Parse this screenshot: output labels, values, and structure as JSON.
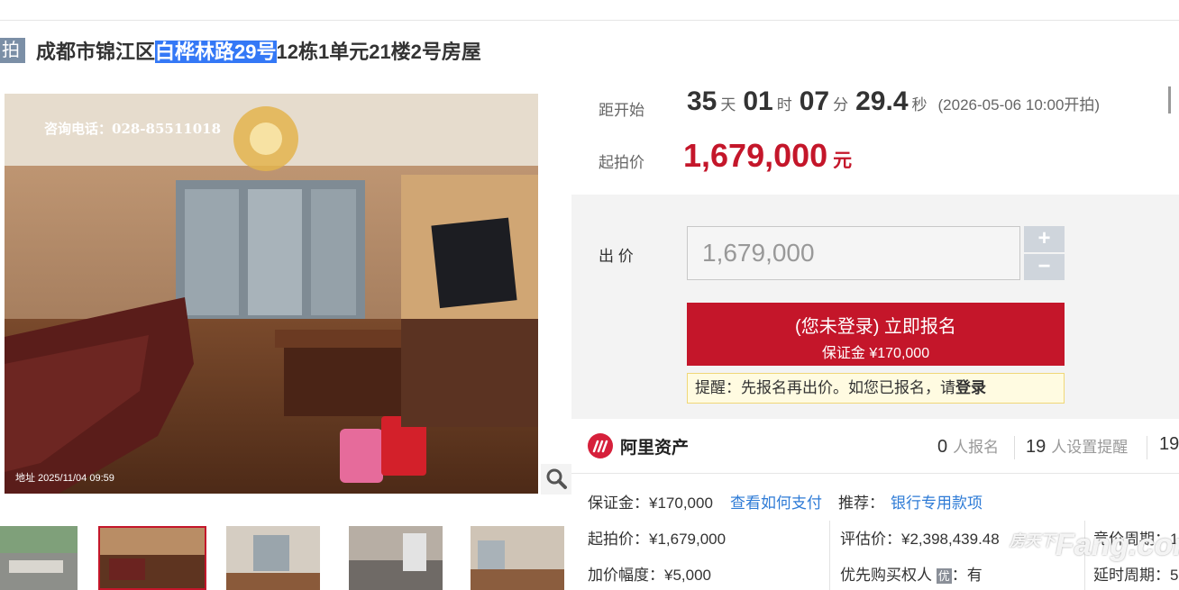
{
  "header": {
    "tag": "拍",
    "title_pre": "成都市锦江区",
    "title_highlight": "白桦林路29号",
    "title_post": "12栋1单元21楼2号房屋"
  },
  "photo": {
    "contact_overlay": "咨询电话：028-85511018",
    "stamp_overlay": "地址  2025/11/04 09:59"
  },
  "auction": {
    "countdown_label": "距开始",
    "days": "35",
    "days_unit": "天",
    "hours": "01",
    "hours_unit": "时",
    "minutes": "07",
    "minutes_unit": "分",
    "seconds": "29.4",
    "seconds_unit": "秒",
    "start_note": "(2026-05-06 10:00开拍)",
    "start_price_label": "起拍价",
    "start_price": "1,679,000",
    "start_price_unit": "元"
  },
  "bid": {
    "label": "出 价",
    "input_placeholder": "1,679,000",
    "plus": "+",
    "minus": "−",
    "signup_line1": "(您未登录) 立即报名",
    "signup_line2": "保证金 ¥170,000",
    "reminder_text": "提醒：先报名再出价。如您已报名，请",
    "reminder_link": "登录"
  },
  "platform": {
    "name": "阿里资产",
    "signups_count": "0",
    "signups_label": "人报名",
    "reminders_count": "19",
    "reminders_label": "人设置提醒",
    "views_count": "19"
  },
  "details": {
    "deposit": "保证金：¥170,000",
    "how_to_pay": "查看如何支付",
    "recommend_label": "推荐：",
    "recommend_link": "银行专用款项",
    "start_price": "起拍价：¥1,679,000",
    "appraisal": "评估价：¥2,398,439.48",
    "bid_cycle": "竞价周期：1",
    "increment": "加价幅度：¥5,000",
    "priority_label": "优先购买权人",
    "priority_badge": "优",
    "priority_value": "：有",
    "delay_cycle": "延时周期：5"
  },
  "watermark": "Fang.com",
  "watermark_cn": "房天下",
  "colors": {
    "accent_red": "#c4162a",
    "link_blue": "#2e7bd6",
    "highlight": "#3478f6"
  }
}
